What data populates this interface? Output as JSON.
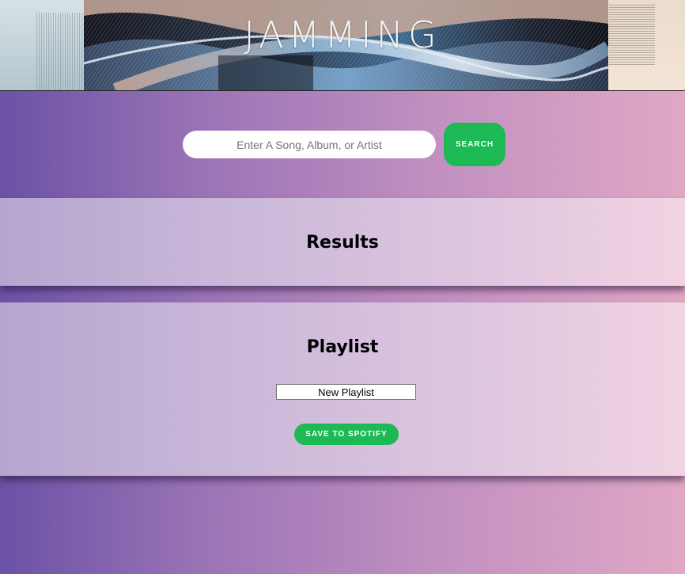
{
  "header": {
    "title": "JAMMING",
    "banner_image": "abstract-wave-art"
  },
  "search": {
    "placeholder": "Enter A Song, Album, or Artist",
    "value": "",
    "button_label": "SEARCH"
  },
  "results": {
    "heading": "Results",
    "tracks": []
  },
  "playlist": {
    "heading": "Playlist",
    "name_value": "New Playlist",
    "tracks": [],
    "save_label": "SAVE TO SPOTIFY"
  },
  "colors": {
    "accent": "#1db954",
    "gradient_start": "#6b52a6",
    "gradient_end": "#e0a8c5"
  }
}
